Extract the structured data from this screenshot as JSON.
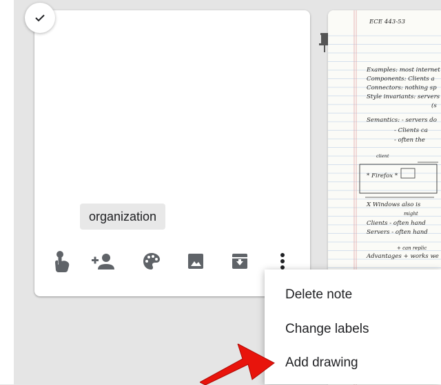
{
  "note": {
    "label_chip": "organization",
    "toolbar_icons": [
      "touch-reminder-icon",
      "add-collaborator-icon",
      "palette-icon",
      "image-icon",
      "archive-icon",
      "more-vert-icon"
    ]
  },
  "image_card": {
    "handwriting_lines": [
      "ECE 443-53",
      "Examples: most internet",
      "Components: Clients a",
      "Connectors: nothing sp",
      "Style invariants: servers",
      "(s",
      "Semantics: - servers do",
      "- Clients ca",
      "- often the",
      "client",
      "* Firefox *",
      "X Windows also is",
      "might",
      "Clients - often hand",
      "Servers - often hand",
      "+ can replic",
      "Advantages + works we"
    ]
  },
  "menu": {
    "items": [
      "Delete note",
      "Change labels",
      "Add drawing"
    ]
  },
  "colors": {
    "arrow": "#e8140c",
    "page_bg": "#e5e5e5"
  }
}
